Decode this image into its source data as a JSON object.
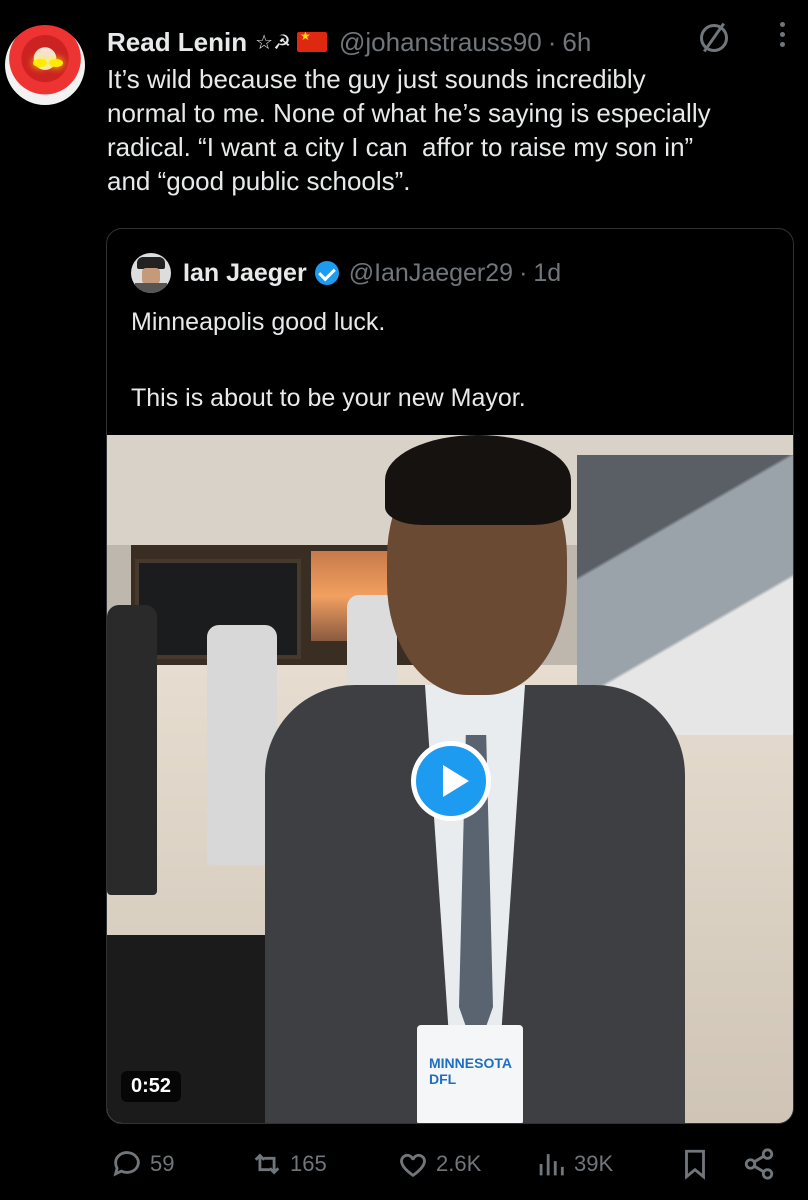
{
  "tweet": {
    "author": {
      "display_name": "Read Lenin",
      "name_emoji": "☆☭",
      "handle": "@johanstrauss90",
      "time": "6h"
    },
    "separator": "·",
    "text": "It’s wild because the guy just sounds incredibly\nnormal to me. None of what he’s saying is especially\nradical. “I want a city I can  affor to raise my son in”\nand “good public schools”.",
    "quote": {
      "display_name": "Ian Jaeger",
      "handle": "@IanJaeger29",
      "time": "1d",
      "text": "Minneapolis good luck.\n\nThis is about to be your new Mayor.",
      "video": {
        "duration": "0:52",
        "badge_text": "MINNESOTA DFL"
      }
    },
    "actions": {
      "replies": "59",
      "retweets": "165",
      "likes": "2.6K",
      "views": "39K"
    }
  },
  "colors": {
    "background": "#000000",
    "text": "#e7e9ea",
    "muted": "#71767b",
    "accent": "#1d9bf0"
  }
}
